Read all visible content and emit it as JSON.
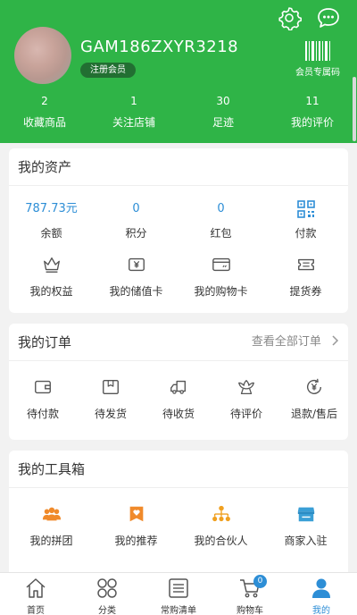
{
  "profile": {
    "username": "GAM186ZXYR3218",
    "member_badge": "注册会员",
    "member_code_label": "会员专属码",
    "settings_icon": "gear-icon",
    "message_icon": "chat-icon"
  },
  "stats": [
    {
      "value": "2",
      "label": "收藏商品"
    },
    {
      "value": "1",
      "label": "关注店铺"
    },
    {
      "value": "30",
      "label": "足迹"
    },
    {
      "value": "11",
      "label": "我的评价"
    }
  ],
  "assets": {
    "title": "我的资产",
    "values": [
      {
        "value": "787.73元",
        "label": "余额"
      },
      {
        "value": "0",
        "label": "积分"
      },
      {
        "value": "0",
        "label": "红包"
      },
      {
        "value": "",
        "label": "付款",
        "icon": "qr-code-icon"
      }
    ],
    "items": [
      {
        "label": "我的权益",
        "icon": "crown-icon"
      },
      {
        "label": "我的储值卡",
        "icon": "stored-value-card-icon"
      },
      {
        "label": "我的购物卡",
        "icon": "shopping-card-icon"
      },
      {
        "label": "提货券",
        "icon": "voucher-icon"
      }
    ]
  },
  "orders": {
    "title": "我的订单",
    "view_all": "查看全部订单",
    "items": [
      {
        "label": "待付款",
        "icon": "wallet-icon"
      },
      {
        "label": "待发货",
        "icon": "package-icon"
      },
      {
        "label": "待收货",
        "icon": "truck-icon"
      },
      {
        "label": "待评价",
        "icon": "review-icon"
      },
      {
        "label": "退款/售后",
        "icon": "refund-icon"
      }
    ]
  },
  "toolbox": {
    "title": "我的工具箱",
    "items": [
      {
        "label": "我的拼团",
        "icon": "group-buy-icon"
      },
      {
        "label": "我的推荐",
        "icon": "recommend-icon"
      },
      {
        "label": "我的合伙人",
        "icon": "partner-icon"
      },
      {
        "label": "商家入驻",
        "icon": "store-icon"
      }
    ]
  },
  "tabbar": {
    "items": [
      {
        "label": "首页",
        "icon": "home-icon"
      },
      {
        "label": "分类",
        "icon": "category-icon"
      },
      {
        "label": "常购清单",
        "icon": "list-icon"
      },
      {
        "label": "购物车",
        "icon": "cart-icon",
        "badge": "0"
      },
      {
        "label": "我的",
        "icon": "user-icon"
      }
    ],
    "active_index": 4
  },
  "colors": {
    "brand_green": "#2fb447",
    "accent_blue": "#2d8ed6",
    "tool_orange": "#f08a2b"
  }
}
